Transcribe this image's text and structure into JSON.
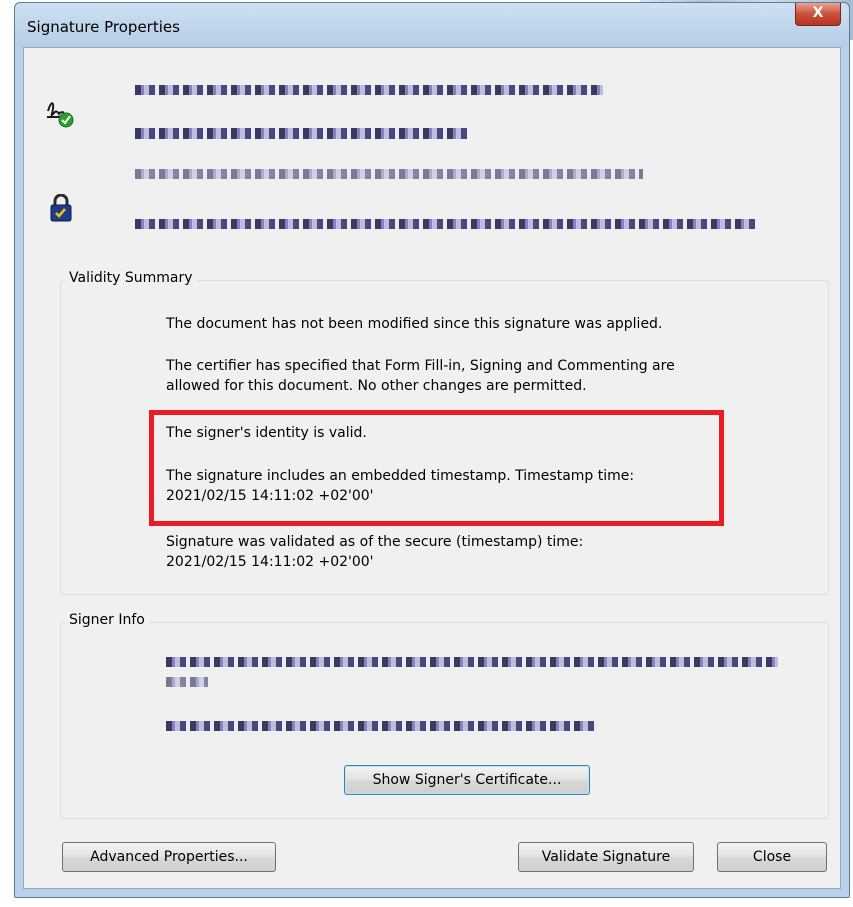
{
  "window": {
    "title": "Signature Properties",
    "close_glyph": "X"
  },
  "header": {
    "signature_icon": "signature-valid-icon",
    "lock_icon": "certified-lock-icon"
  },
  "validity": {
    "legend": "Validity Summary",
    "line1": "The document has not been modified since this signature was applied.",
    "line2a": "The certifier has specified that Form Fill-in, Signing and Commenting are",
    "line2b": "allowed for this document. No other changes are permitted.",
    "line3": "The signer's identity is valid.",
    "line4a": "The signature includes an embedded timestamp. Timestamp time:",
    "line4b": "2021/02/15 14:11:02 +02'00'",
    "line5a": "Signature was validated as of the secure (timestamp) time:",
    "line5b": "2021/02/15 14:11:02 +02'00'"
  },
  "signer": {
    "legend": "Signer Info",
    "show_cert_label": "Show Signer's Certificate..."
  },
  "footer": {
    "advanced_label": "Advanced Properties...",
    "validate_label": "Validate Signature",
    "close_label": "Close"
  },
  "colors": {
    "highlight": "#ed1c24",
    "dialog_bg": "#f0f0f0"
  }
}
